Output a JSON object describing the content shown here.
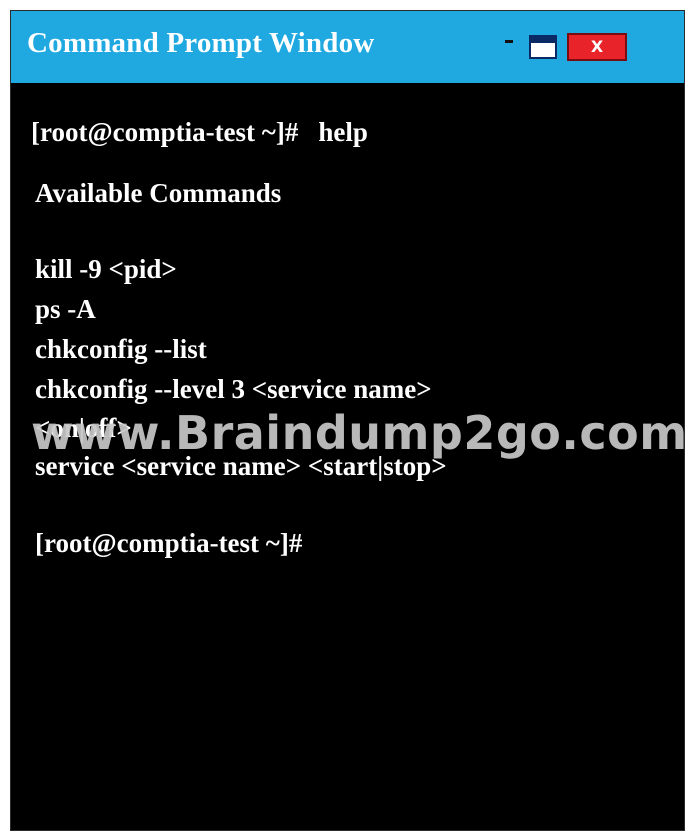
{
  "window": {
    "title": "Command Prompt Window",
    "minimize_glyph": "-",
    "close_label": "X",
    "title_bar_color": "#1fa9e0",
    "close_button_color": "#e8232a",
    "maximize_button_color": "#0a2a66"
  },
  "terminal": {
    "prompt_line": {
      "prompt": "[root@comptia-test ~]#",
      "command": "help"
    },
    "heading": "Available Commands",
    "commands": [
      "kill -9 <pid>",
      "ps -A",
      "chkconfig --list",
      "chkconfig --level 3 <service name>",
      "<on|off>",
      "service <service name> <start|stop>"
    ],
    "final_prompt": "[root@comptia-test ~]#",
    "background_color": "#000000",
    "text_color": "#ffffff"
  },
  "watermark": {
    "text": "www.Braindump2go.com"
  }
}
